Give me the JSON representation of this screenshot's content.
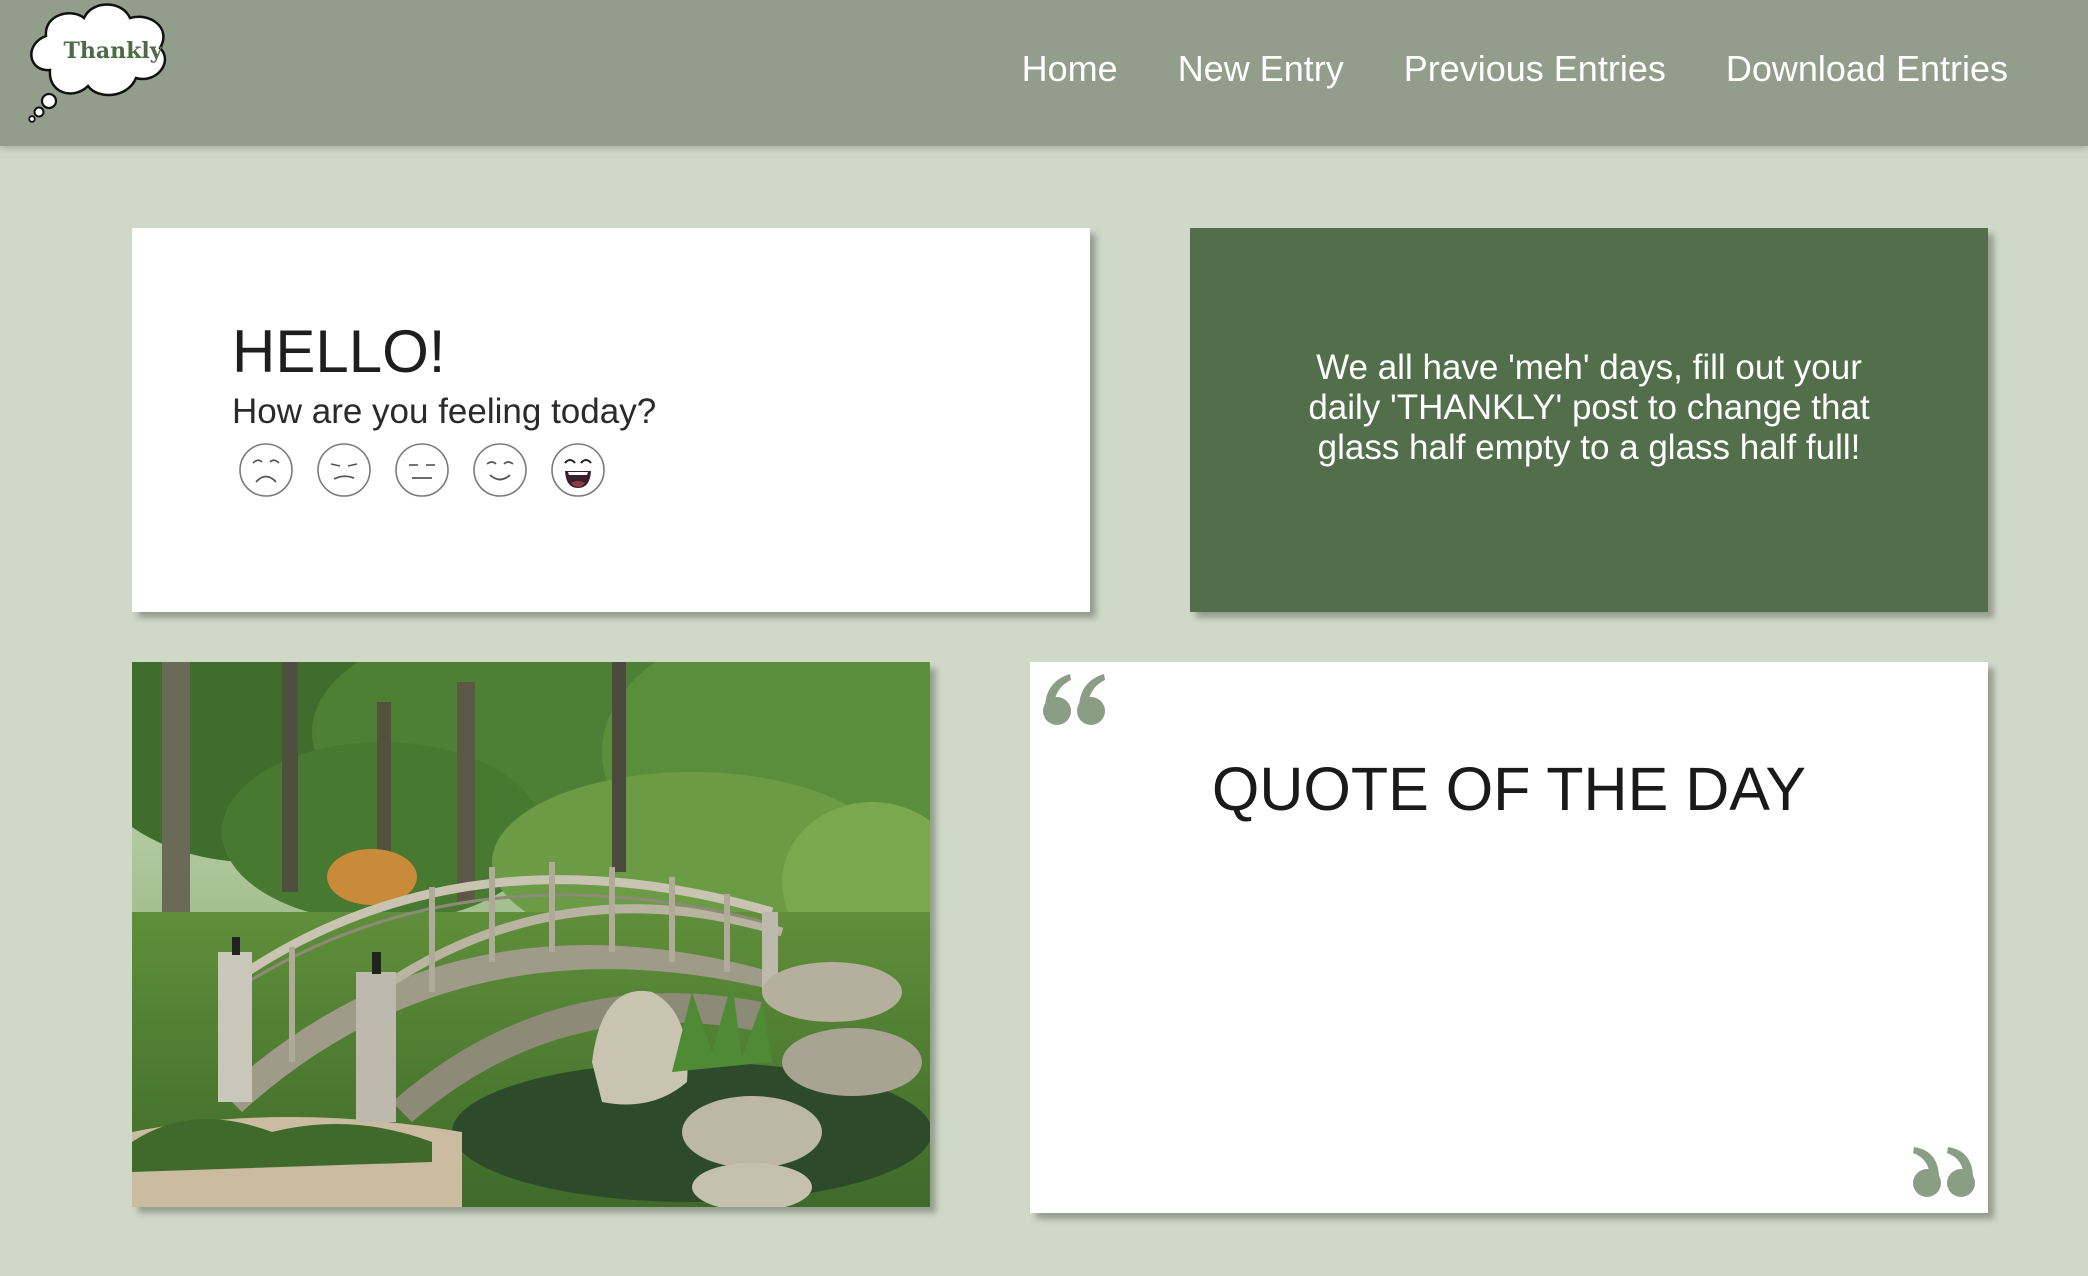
{
  "logo": {
    "text": "Thankly"
  },
  "nav": {
    "home": "Home",
    "new_entry": "New Entry",
    "previous_entries": "Previous Entries",
    "download_entries": "Download Entries"
  },
  "hello": {
    "title": "HELLO!",
    "subtitle": "How are you feeling today?",
    "moods": [
      "very-sad-icon",
      "sad-icon",
      "neutral-icon",
      "happy-icon",
      "very-happy-icon"
    ]
  },
  "message": {
    "text": "We all have 'meh' days, fill out your daily 'THANKLY' post to change that glass half empty to a glass half full!"
  },
  "quote": {
    "title": "QUOTE OF THE DAY"
  },
  "colors": {
    "navbar": "#929e8b",
    "background": "#d0d9c8",
    "accent_green": "#526e4b",
    "quote_mark": "#8a9e86"
  }
}
